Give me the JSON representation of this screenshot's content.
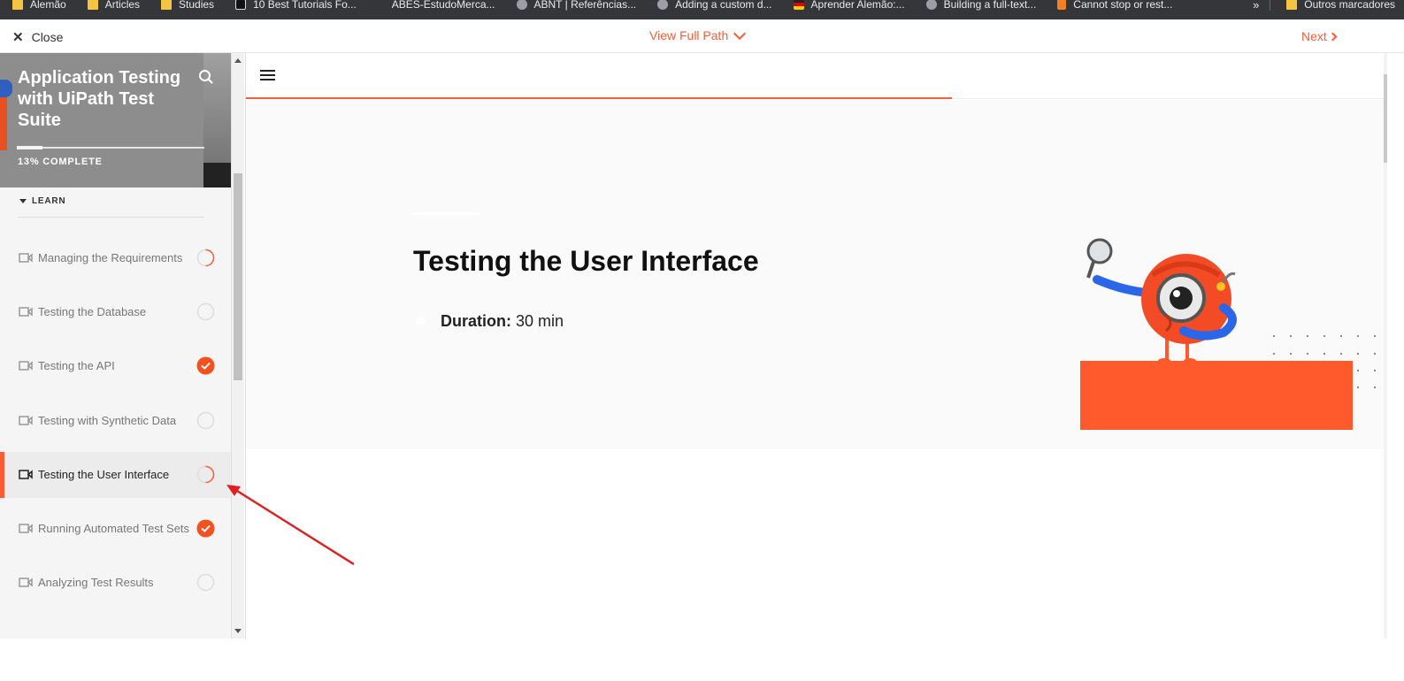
{
  "bookmarks": [
    {
      "label": "Alemão",
      "icon": "folder"
    },
    {
      "label": "Articles",
      "icon": "folder"
    },
    {
      "label": "Studies",
      "icon": "folder"
    },
    {
      "label": "10 Best Tutorials Fo...",
      "icon": "dark"
    },
    {
      "label": "ABES-EstudoMerca...",
      "icon": "none"
    },
    {
      "label": "ABNT | Referências...",
      "icon": "globe"
    },
    {
      "label": "Adding a custom d...",
      "icon": "globe"
    },
    {
      "label": "Aprender Alemão:...",
      "icon": "flag"
    },
    {
      "label": "Building a full-text...",
      "icon": "globe"
    },
    {
      "label": "Cannot stop or rest...",
      "icon": "so"
    }
  ],
  "bookmarks_more": "»",
  "bookmarks_other": "Outros marcadores",
  "topbar": {
    "close_label": "Close",
    "close_icon": "close-icon",
    "view_path_label": "View Full Path",
    "next_label": "Next"
  },
  "course": {
    "title": "Application Testing with UiPath Test Suite",
    "progress_percent": 13,
    "complete_label": "13% COMPLETE",
    "section_label": "LEARN"
  },
  "lessons": [
    {
      "label": "Managing the Requirements",
      "status": "in-progress",
      "active": false
    },
    {
      "label": "Testing the Database",
      "status": "not-started",
      "active": false
    },
    {
      "label": "Testing the API",
      "status": "completed",
      "active": false
    },
    {
      "label": "Testing with Synthetic Data",
      "status": "not-started",
      "active": false
    },
    {
      "label": "Testing the User Interface",
      "status": "in-progress",
      "active": true
    },
    {
      "label": "Running Automated Test Sets",
      "status": "completed",
      "active": false
    },
    {
      "label": "Analyzing Test Results",
      "status": "not-started",
      "active": false
    }
  ],
  "main": {
    "lesson_title": "Testing the User Interface",
    "duration_label": "Duration:",
    "duration_value": "30 min",
    "progress_fraction": 0.62
  },
  "colors": {
    "accent": "#ff5a36",
    "sidebar_bg": "#f5f5f5",
    "hero_bg": "#8d8d8d"
  }
}
